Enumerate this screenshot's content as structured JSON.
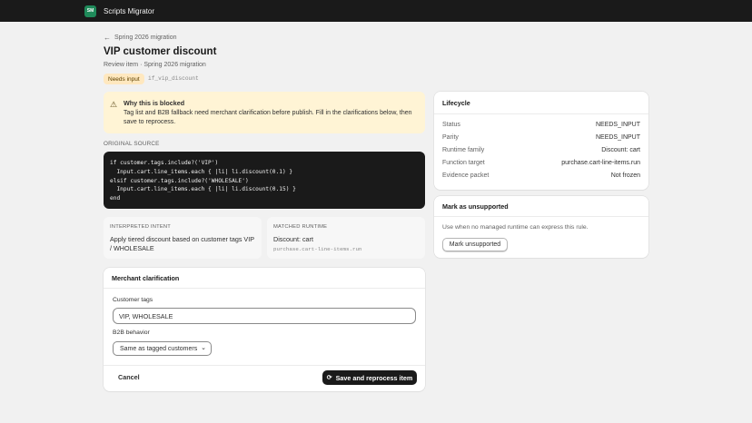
{
  "app": {
    "logo_text": "SM",
    "name": "Scripts Migrator"
  },
  "breadcrumb": {
    "back_label": "Spring 2026 migration"
  },
  "page": {
    "title": "VIP customer discount",
    "subtitle": "Review item · Spring 2026 migration",
    "status_badge": "Needs input",
    "slug": "if_vip_discount"
  },
  "alert": {
    "title": "Why this is blocked",
    "body": "Tag list and B2B fallback need merchant clarification before publish. Fill in the clarifications below, then save to reprocess."
  },
  "source": {
    "label": "ORIGINAL SOURCE",
    "code": "if customer.tags.include?('VIP')\n  Input.cart.line_items.each { |li| li.discount(0.1) }\nelsif customer.tags.include?('WHOLESALE')\n  Input.cart.line_items.each { |li| li.discount(0.15) }\nend"
  },
  "intent": {
    "label": "INTERPRETED INTENT",
    "value": "Apply tiered discount based on customer tags VIP / WHOLESALE"
  },
  "runtime": {
    "label": "MATCHED RUNTIME",
    "value": "Discount: cart",
    "code": "purchase.cart-line-items.run"
  },
  "clarification": {
    "title": "Merchant clarification",
    "tags_label": "Customer tags",
    "tags_value": "VIP, WHOLESALE",
    "b2b_label": "B2B behavior",
    "b2b_value": "Same as tagged customers",
    "cancel_label": "Cancel",
    "save_label": "Save and reprocess item"
  },
  "lifecycle": {
    "title": "Lifecycle",
    "rows": [
      {
        "key": "Status",
        "value": "NEEDS_INPUT"
      },
      {
        "key": "Parity",
        "value": "NEEDS_INPUT"
      },
      {
        "key": "Runtime family",
        "value": "Discount: cart"
      },
      {
        "key": "Function target",
        "value": "purchase.cart-line-items.run"
      },
      {
        "key": "Evidence packet",
        "value": "Not frozen"
      }
    ]
  },
  "unsupported": {
    "title": "Mark as unsupported",
    "description": "Use when no managed runtime can express this rule.",
    "button_label": "Mark unsupported"
  },
  "colors": {
    "topbar": "#1a1a1a",
    "logo": "#1f8a5a",
    "alert_bg": "#fff4d5",
    "badge_bg": "#ffe8bf",
    "primary": "#1a1a1a"
  },
  "icons": [
    "arrow-left-icon",
    "warning-icon",
    "refresh-icon",
    "chevron-down-icon"
  ]
}
